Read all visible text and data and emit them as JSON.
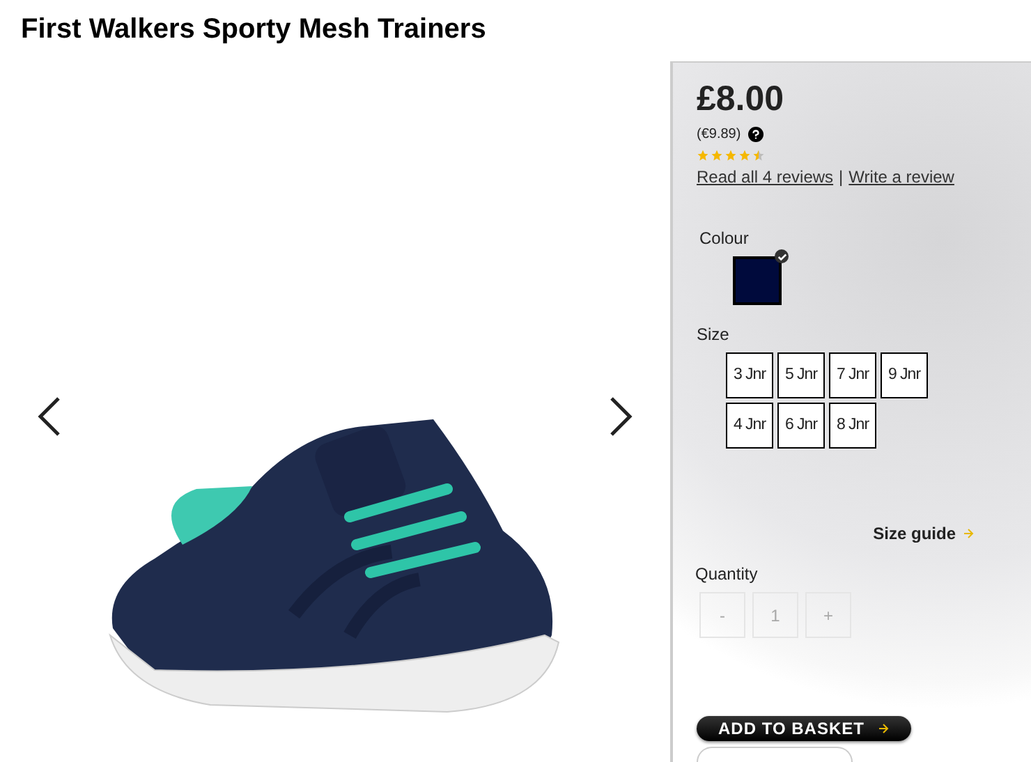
{
  "title": "First Walkers Sporty Mesh Trainers",
  "price": "£8.00",
  "alt_price": "(€9.89)",
  "stars": 4.5,
  "reviews": {
    "read": "Read all 4 reviews",
    "separator": "|",
    "write": "Write a review"
  },
  "colour": {
    "label": "Colour",
    "swatches": [
      {
        "color": "#000a3c",
        "selected": true
      }
    ]
  },
  "size": {
    "label": "Size",
    "options": [
      {
        "label": "3 Jnr",
        "selected": false
      },
      {
        "label": "5 Jnr",
        "selected": false
      },
      {
        "label": "7 Jnr",
        "selected": false
      },
      {
        "label": "9 Jnr",
        "selected": false
      },
      {
        "label": "4 Jnr",
        "selected": false
      },
      {
        "label": "6 Jnr",
        "selected": false
      },
      {
        "label": "8 Jnr",
        "selected": false
      }
    ]
  },
  "size_guide": "Size guide",
  "quantity": {
    "label": "Quantity",
    "minus": "-",
    "value": "1",
    "plus": "+",
    "disabled": true
  },
  "add_button": "ADD TO BASKET"
}
